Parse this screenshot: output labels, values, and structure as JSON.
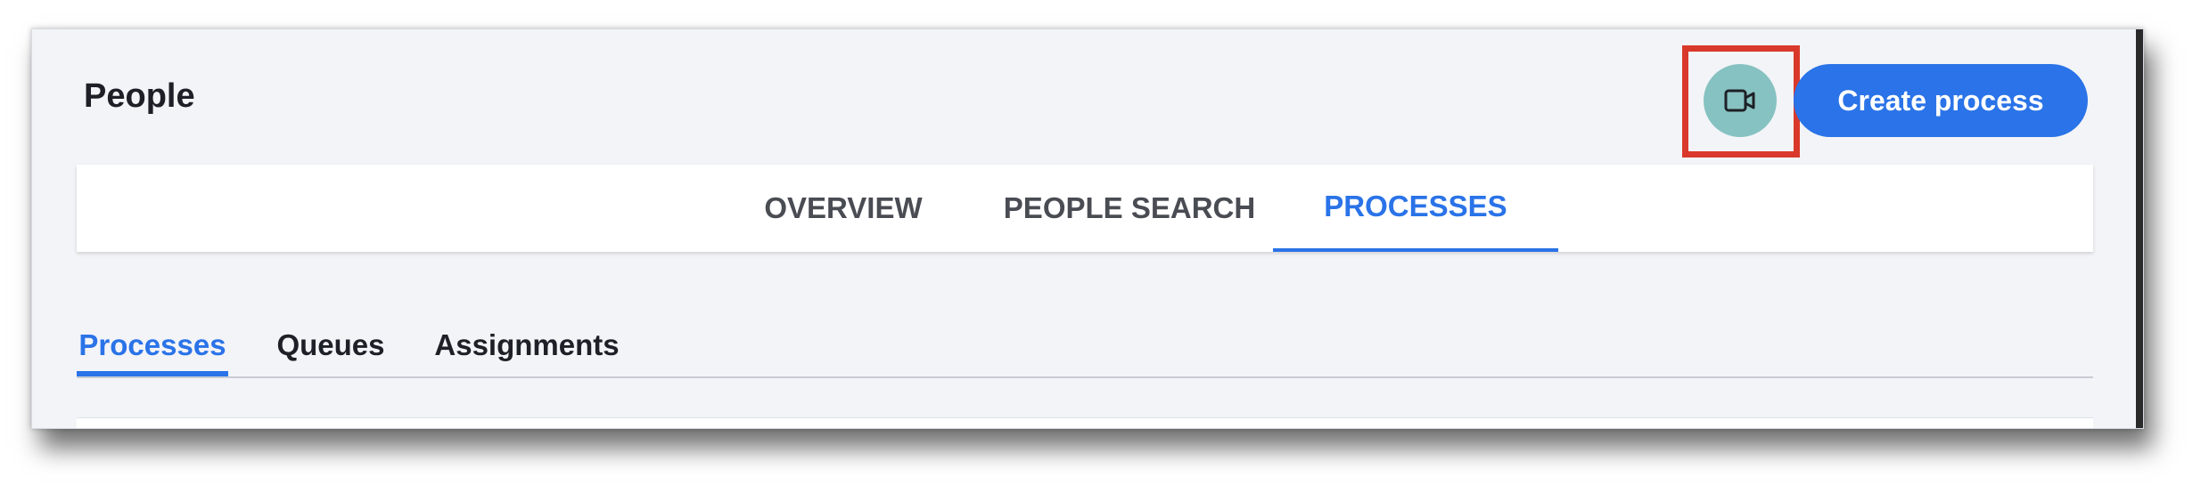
{
  "header": {
    "title": "People",
    "create_button_label": "Create process",
    "camera_icon": "video-camera-icon",
    "colors": {
      "camera_button": "#86c2c1",
      "primary": "#2a73e8",
      "highlight": "#d9392b"
    }
  },
  "main_tabs": [
    {
      "label": "OVERVIEW",
      "active": false
    },
    {
      "label": "PEOPLE SEARCH",
      "active": false
    },
    {
      "label": "PROCESSES",
      "active": true
    }
  ],
  "sub_tabs": [
    {
      "label": "Processes",
      "active": true
    },
    {
      "label": "Queues",
      "active": false
    },
    {
      "label": "Assignments",
      "active": false
    }
  ]
}
